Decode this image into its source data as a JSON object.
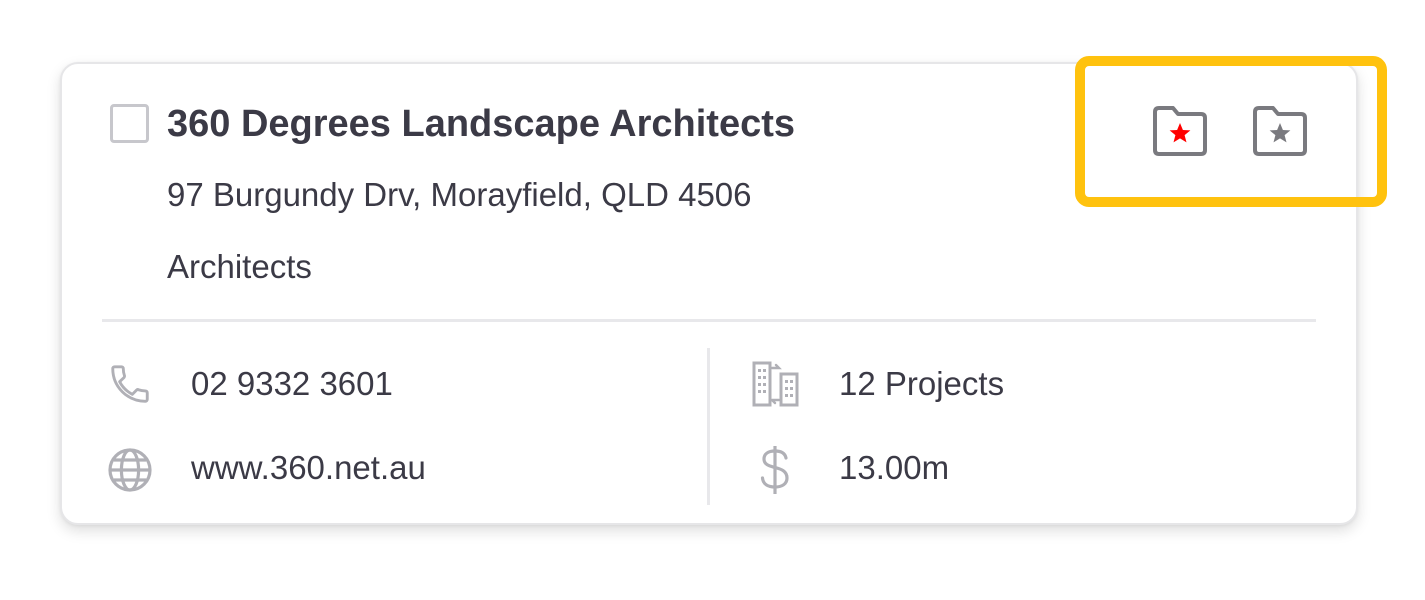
{
  "company": {
    "name": "360 Degrees Landscape Architects",
    "address": "97 Burgundy Drv, Morayfield, QLD 4506",
    "category": "Architects"
  },
  "contact": {
    "phone": "02 9332 3601",
    "website": "www.360.net.au"
  },
  "stats": {
    "projects": "12 Projects",
    "value": "13.00m"
  },
  "actions": {
    "favorite_folder_icon": "folder-red-star-icon",
    "saved_folder_icon": "folder-star-icon"
  },
  "icons": {
    "phone": "phone-icon",
    "website": "globe-icon",
    "projects": "buildings-icon",
    "value": "dollar-icon"
  },
  "colors": {
    "text": "#3b3a46",
    "icon_gray": "#b0b0b6",
    "folder_gray": "#7a7a7f",
    "star_red": "#ff0000",
    "highlight": "#ffc20e",
    "divider": "#e8e8eb"
  }
}
